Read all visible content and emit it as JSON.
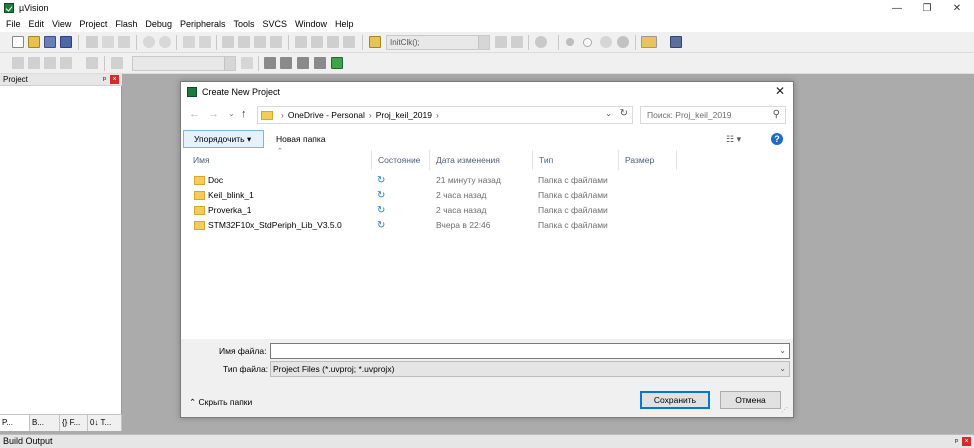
{
  "window": {
    "title": "µVision",
    "min_label": "—",
    "max_label": "❐",
    "close_label": "✕"
  },
  "menu": [
    "File",
    "Edit",
    "View",
    "Project",
    "Flash",
    "Debug",
    "Peripherals",
    "Tools",
    "SVCS",
    "Window",
    "Help"
  ],
  "toolbar": {
    "function_combo": "InitClk();"
  },
  "project_panel": {
    "title": "Project",
    "pin": "ᵖ",
    "close": "×",
    "tabs": [
      "P...",
      "B...",
      "{} F...",
      "0↓ T..."
    ]
  },
  "build_output": {
    "title": "Build Output",
    "pin": "ᵖ",
    "close": "×"
  },
  "dialog": {
    "title": "Create New Project",
    "close": "✕",
    "nav": {
      "back": "←",
      "forward": "→",
      "dropdown": "⌄",
      "up": "↑"
    },
    "breadcrumb": [
      "OneDrive - Personal",
      "Proj_keil_2019"
    ],
    "breadcrumb_separator": "›",
    "refresh": "↻",
    "search_placeholder": "Поиск: Proj_keil_2019",
    "search_icon": "⚲",
    "organize_label": "Упорядочить ▾",
    "new_folder_label": "Новая папка",
    "view_label": "☷ ▾",
    "help_label": "?",
    "sort_arrow": "⌃",
    "columns": [
      "Имя",
      "Состояние",
      "Дата изменения",
      "Тип",
      "Размер"
    ],
    "files": [
      {
        "name": "Doc",
        "status_icon": "↻",
        "date": "21 минуту назад",
        "type": "Папка с файлами"
      },
      {
        "name": "Keil_blink_1",
        "status_icon": "↻",
        "date": "2 часа назад",
        "type": "Папка с файлами"
      },
      {
        "name": "Proverka_1",
        "status_icon": "↻",
        "date": "2 часа назад",
        "type": "Папка с файлами"
      },
      {
        "name": "STM32F10x_StdPeriph_Lib_V3.5.0",
        "status_icon": "↻",
        "date": "Вчера в 22:46",
        "type": "Папка с файлами"
      }
    ],
    "filename_label": "Имя файла:",
    "filename_value": "",
    "filetype_label": "Тип файла:",
    "filetype_value": "Project Files (*.uvproj; *.uvprojx)",
    "dropdown_arrow": "⌄",
    "hide_folders_label": "⌃  Скрыть папки",
    "save_label": "Сохранить",
    "cancel_label": "Отмена",
    "grip": "⋰"
  }
}
